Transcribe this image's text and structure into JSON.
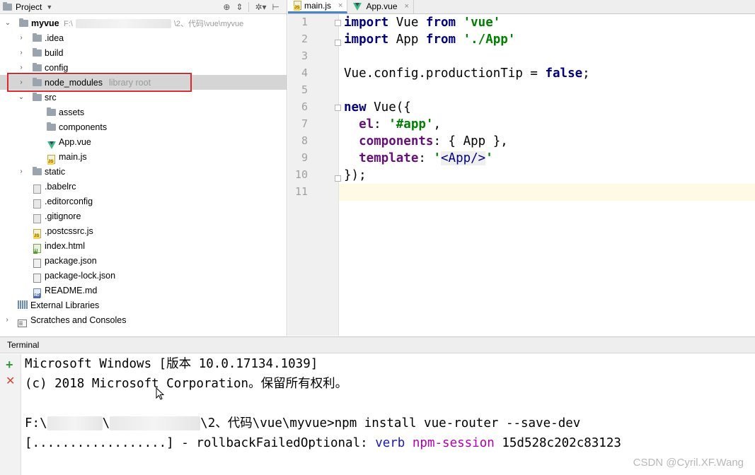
{
  "project_panel": {
    "title": "Project",
    "header_icons": [
      "target-icon",
      "collapse-icon",
      "gear-icon",
      "hide-icon"
    ],
    "tree": [
      {
        "label": "myvue",
        "hint": "F:\\",
        "hint2": "\\2、代码\\vue\\myvue",
        "icon": "module-folder-icon",
        "expanded": true
      },
      {
        "label": ".idea",
        "icon": "folder-icon"
      },
      {
        "label": "build",
        "icon": "folder-icon"
      },
      {
        "label": "config",
        "icon": "folder-icon"
      },
      {
        "label": "node_modules",
        "hint": "library root",
        "icon": "folder-icon"
      },
      {
        "label": "src",
        "icon": "folder-icon",
        "expanded": true
      },
      {
        "label": "assets",
        "icon": "folder-icon"
      },
      {
        "label": "components",
        "icon": "folder-icon"
      },
      {
        "label": "App.vue",
        "icon": "vue-file-icon"
      },
      {
        "label": "main.js",
        "icon": "js-file-icon"
      },
      {
        "label": "static",
        "icon": "folder-icon"
      },
      {
        "label": ".babelrc",
        "icon": "file-icon"
      },
      {
        "label": ".editorconfig",
        "icon": "file-icon"
      },
      {
        "label": ".gitignore",
        "icon": "file-icon"
      },
      {
        "label": ".postcssrc.js",
        "icon": "js-file-icon"
      },
      {
        "label": "index.html",
        "icon": "html-file-icon"
      },
      {
        "label": "package.json",
        "icon": "json-file-icon"
      },
      {
        "label": "package-lock.json",
        "icon": "json-file-icon"
      },
      {
        "label": "README.md",
        "icon": "md-file-icon"
      },
      {
        "label": "External Libraries",
        "icon": "libraries-icon"
      },
      {
        "label": "Scratches and Consoles",
        "icon": "scratches-icon"
      }
    ]
  },
  "editor": {
    "tabs": [
      {
        "label": "main.js",
        "active": true
      },
      {
        "label": "App.vue",
        "active": false
      }
    ],
    "line_numbers": [
      "1",
      "2",
      "3",
      "4",
      "5",
      "6",
      "7",
      "8",
      "9",
      "10",
      "11"
    ],
    "code": {
      "l1": [
        "import",
        " Vue ",
        "from",
        " ",
        "'vue'"
      ],
      "l2": [
        "import",
        " App ",
        "from",
        " ",
        "'./App'"
      ],
      "l4": [
        "Vue.config.productionTip = ",
        "false",
        ";"
      ],
      "l6": [
        "new",
        " Vue({"
      ],
      "l7": [
        "  ",
        "el",
        ": ",
        "'#app'",
        ","
      ],
      "l8": [
        "  ",
        "components",
        ": { App },"
      ],
      "l9": [
        "  ",
        "template",
        ": ",
        "'",
        "<App/>",
        "'"
      ],
      "l10": [
        "});"
      ]
    }
  },
  "terminal": {
    "title": "Terminal",
    "lines": {
      "t1": "Microsoft Windows [版本 10.0.17134.1039]",
      "t2": "(c) 2018 Microsoft Corporation。保留所有权利。",
      "t4a": "F:\\",
      "t4b": "\\",
      "t4c": "\\2、代码\\vue\\myvue>npm install vue-router --save-dev",
      "t5a": "[..................] - rollbackFailedOptional: ",
      "t5b": "verb",
      "t5c": " ",
      "t5d": "npm-session",
      "t5e": " 15d528c202c83123"
    },
    "side_buttons": [
      "add-icon",
      "close-icon"
    ]
  },
  "watermark": "CSDN @Cyril.XF.Wang",
  "colors": {
    "keyword": "#000080",
    "string": "#008000",
    "property": "#660e7a",
    "highlight_box": "#e0262d",
    "verb": "#1a1ab0",
    "npm_session": "#b000b0"
  }
}
